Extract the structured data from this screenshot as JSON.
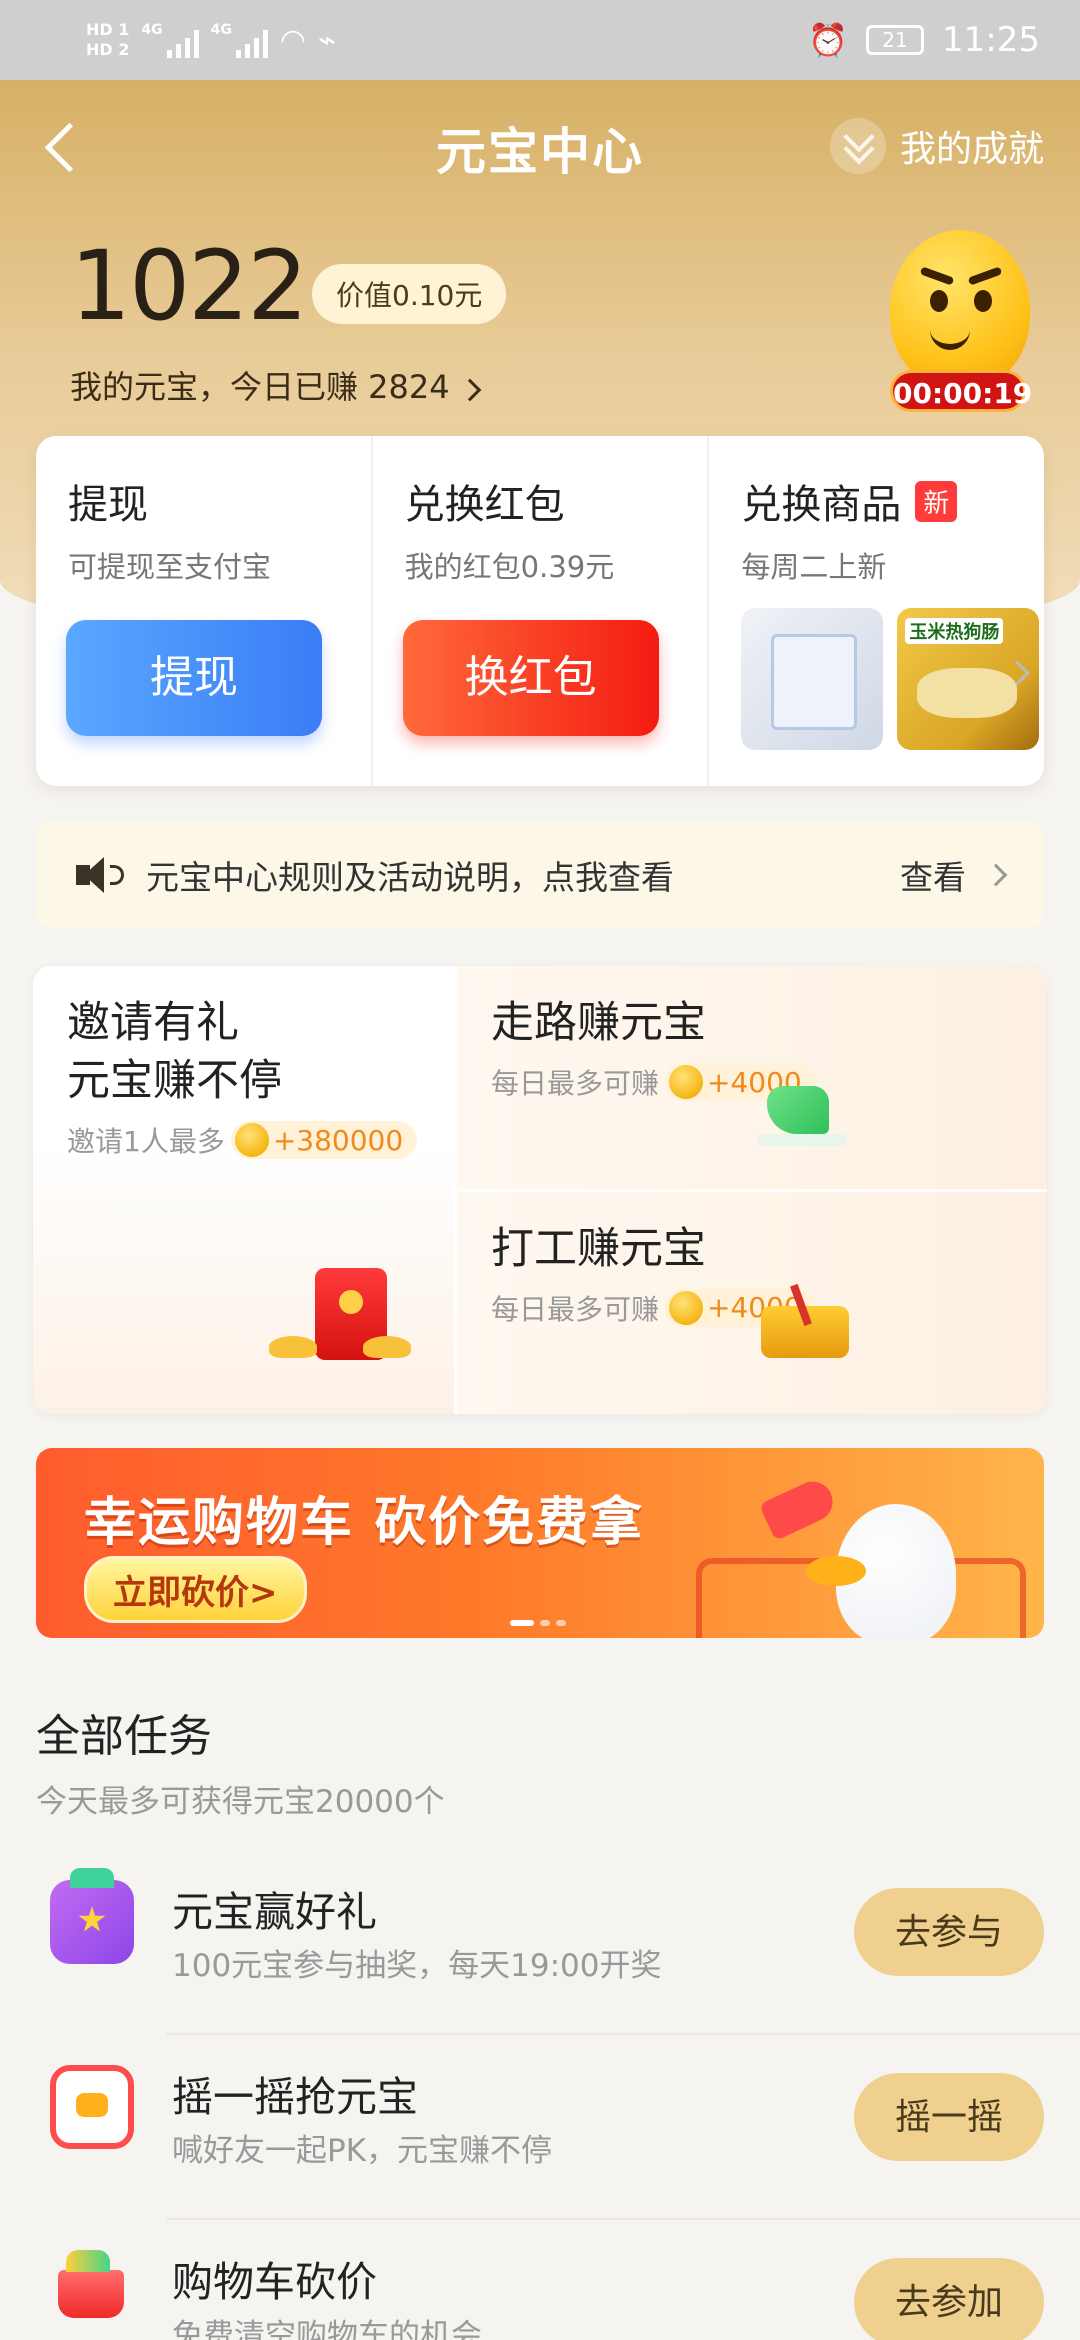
{
  "status_bar": {
    "hd1": "HD 1",
    "hd2": "HD 2",
    "net1": "4G",
    "net2": "4G",
    "battery": "21",
    "time": "11:25"
  },
  "nav": {
    "title": "元宝中心",
    "achievement": "我的成就"
  },
  "balance": {
    "amount": "1022",
    "value_label": "价值0.10元",
    "earned_label": "我的元宝，今日已赚 2824",
    "timer": "00:00:19"
  },
  "actions": [
    {
      "title": "提现",
      "sub": "可提现至支付宝",
      "button": "提现"
    },
    {
      "title": "兑换红包",
      "sub": "我的红包0.39元",
      "button": "换红包"
    },
    {
      "title": "兑换商品",
      "badge": "新",
      "sub": "每周二上新",
      "goods_label": "玉米热狗肠"
    }
  ],
  "notice": {
    "text": "元宝中心规则及活动说明，点我查看",
    "link": "查看"
  },
  "earn": {
    "invite": {
      "title_line1": "邀请有礼",
      "title_line2": "元宝赚不停",
      "sub": "邀请1人最多",
      "reward": "+380000"
    },
    "walk": {
      "title": "走路赚元宝",
      "sub": "每日最多可赚",
      "reward": "+4000"
    },
    "work": {
      "title": "打工赚元宝",
      "sub": "每日最多可赚",
      "reward": "+4000"
    }
  },
  "banner": {
    "title": "幸运购物车 砍价免费拿",
    "button": "立即砍价>"
  },
  "tasks": {
    "title": "全部任务",
    "sub": "今天最多可获得元宝20000个",
    "items": [
      {
        "name": "元宝赢好礼",
        "desc": "100元宝参与抽奖，每天19:00开奖",
        "button": "去参与"
      },
      {
        "name": "摇一摇抢元宝",
        "desc": "喊好友一起PK，元宝赚不停",
        "button": "摇一摇"
      },
      {
        "name": "购物车砍价",
        "desc": "免费清空购物车的机会",
        "button": "去参加"
      }
    ]
  }
}
